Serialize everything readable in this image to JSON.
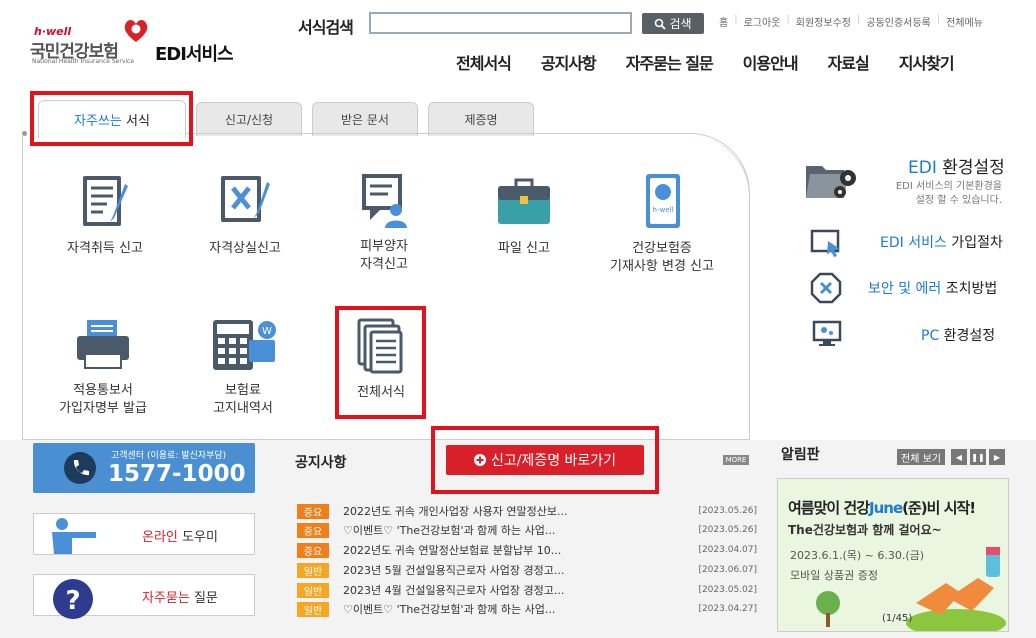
{
  "header": {
    "logo_hwell": "h·well",
    "logo_name": "국민건강보험",
    "logo_sub": "National Health Insurance Service",
    "service_name": "EDI서비스",
    "search_label": "서식검색",
    "search_value": "",
    "search_button": "검색",
    "top_links": [
      "홈",
      "로그아웃",
      "회원정보수정",
      "공동인증서등록",
      "전체메뉴"
    ],
    "gnb": [
      "전체서식",
      "공지사항",
      "자주묻는 질문",
      "이용안내",
      "자료실",
      "지사찾기"
    ]
  },
  "tabs": [
    {
      "hl": "자주쓰는",
      "rest": " 서식"
    },
    {
      "label": "신고/신청"
    },
    {
      "label": "받은 문서"
    },
    {
      "label": "제증명"
    }
  ],
  "services": [
    {
      "line1": "자격취득 신고",
      "line2": ""
    },
    {
      "line1": "자격상실신고",
      "line2": ""
    },
    {
      "line1": "피부양자",
      "line2": "자격신고"
    },
    {
      "line1": "파일 신고",
      "line2": ""
    },
    {
      "line1": "건강보험증",
      "line2": "기재사항 변경 신고"
    },
    {
      "line1": "적용통보서",
      "line2": "가입자명부 발급"
    },
    {
      "line1": "보험료",
      "line2": "고지내역서"
    },
    {
      "line1": "전체서식",
      "line2": ""
    }
  ],
  "right": {
    "env_title_hl": "EDI",
    "env_title_rest": " 환경설정",
    "env_desc1": "EDI 서비스의 기본환경을",
    "env_desc2": "설정 할 수 있습니다.",
    "links": [
      {
        "hl": "EDI 서비스",
        "rest": " 가입절차"
      },
      {
        "hl": "보안 및 에러",
        "rest": " 조치방법"
      },
      {
        "hl": "PC",
        "rest": " 환경설정"
      }
    ]
  },
  "bottom": {
    "callcenter_label": "고객센터 (이용료: 발신자부담)",
    "callcenter_number": "1577-1000",
    "online_help_hl": "온라인",
    "online_help_rest": " 도우미",
    "faq_hl": "자주묻는",
    "faq_rest": " 질문",
    "notice_title": "공지사항",
    "more": "MORE",
    "quick_button": "신고/제증명 바로가기",
    "notices": [
      {
        "badge": "중요",
        "text": "2022년도 귀속 개인사업장 사용자 연말정산보...",
        "date": "[2023.05.26]"
      },
      {
        "badge": "중요",
        "text": "♡이벤트♡ 'The건강보험'과 함께 하는 사업...",
        "date": "[2023.05.26]"
      },
      {
        "badge": "중요",
        "text": "2022년도 귀속 연말정산보험료 분할납부 10...",
        "date": "[2023.04.07]"
      },
      {
        "badge": "일반",
        "text": "2023년 5월 건설일용직근로자 사업장 경정고...",
        "date": "[2023.06.07]"
      },
      {
        "badge": "일반",
        "text": "2023년 4월 건설일용직근로자 사업장 경정고...",
        "date": "[2023.05.02]"
      },
      {
        "badge": "일반",
        "text": "♡이벤트♡ 'The건강보험'과 함께 하는 사업...",
        "date": "[2023.04.27]"
      }
    ],
    "board_title": "알림판",
    "board_all": "전체 보기",
    "banner_line1a": "여름맞이 건강",
    "banner_line1b": "June",
    "banner_line1c": "(준)비 시작!",
    "banner_line2": "The건강보험과 함께 걸어요~",
    "banner_line3": "2023.6.1.(목) ~ 6.30.(금)",
    "banner_line4": "모바일 상품권 증정",
    "banner_page": "(1/45)"
  },
  "colors": {
    "accent": "#1a7bd8",
    "red": "#e0141c",
    "important": "#f07f1a",
    "general": "#f5a623"
  }
}
